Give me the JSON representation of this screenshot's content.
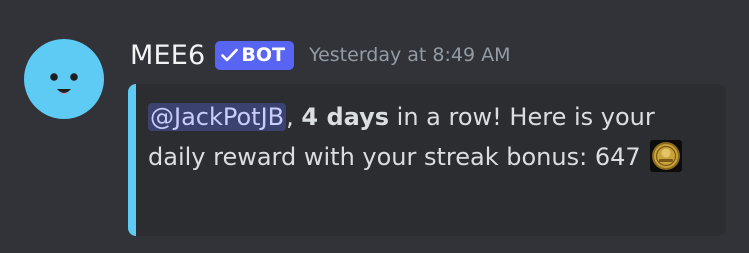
{
  "message": {
    "author": "MEE6",
    "bot_tag": "BOT",
    "timestamp": "Yesterday at 8:49 AM",
    "avatar_icon": "smiley-face-avatar",
    "accent_color": "#5dcbf4"
  },
  "embed": {
    "mention": "@JackPotJB",
    "comma": ",",
    "streak_bold": "4 days",
    "text_after": " in a row! Here is your daily reward with your streak bonus: 647 ",
    "coin_icon": "gold-coin-icon"
  }
}
